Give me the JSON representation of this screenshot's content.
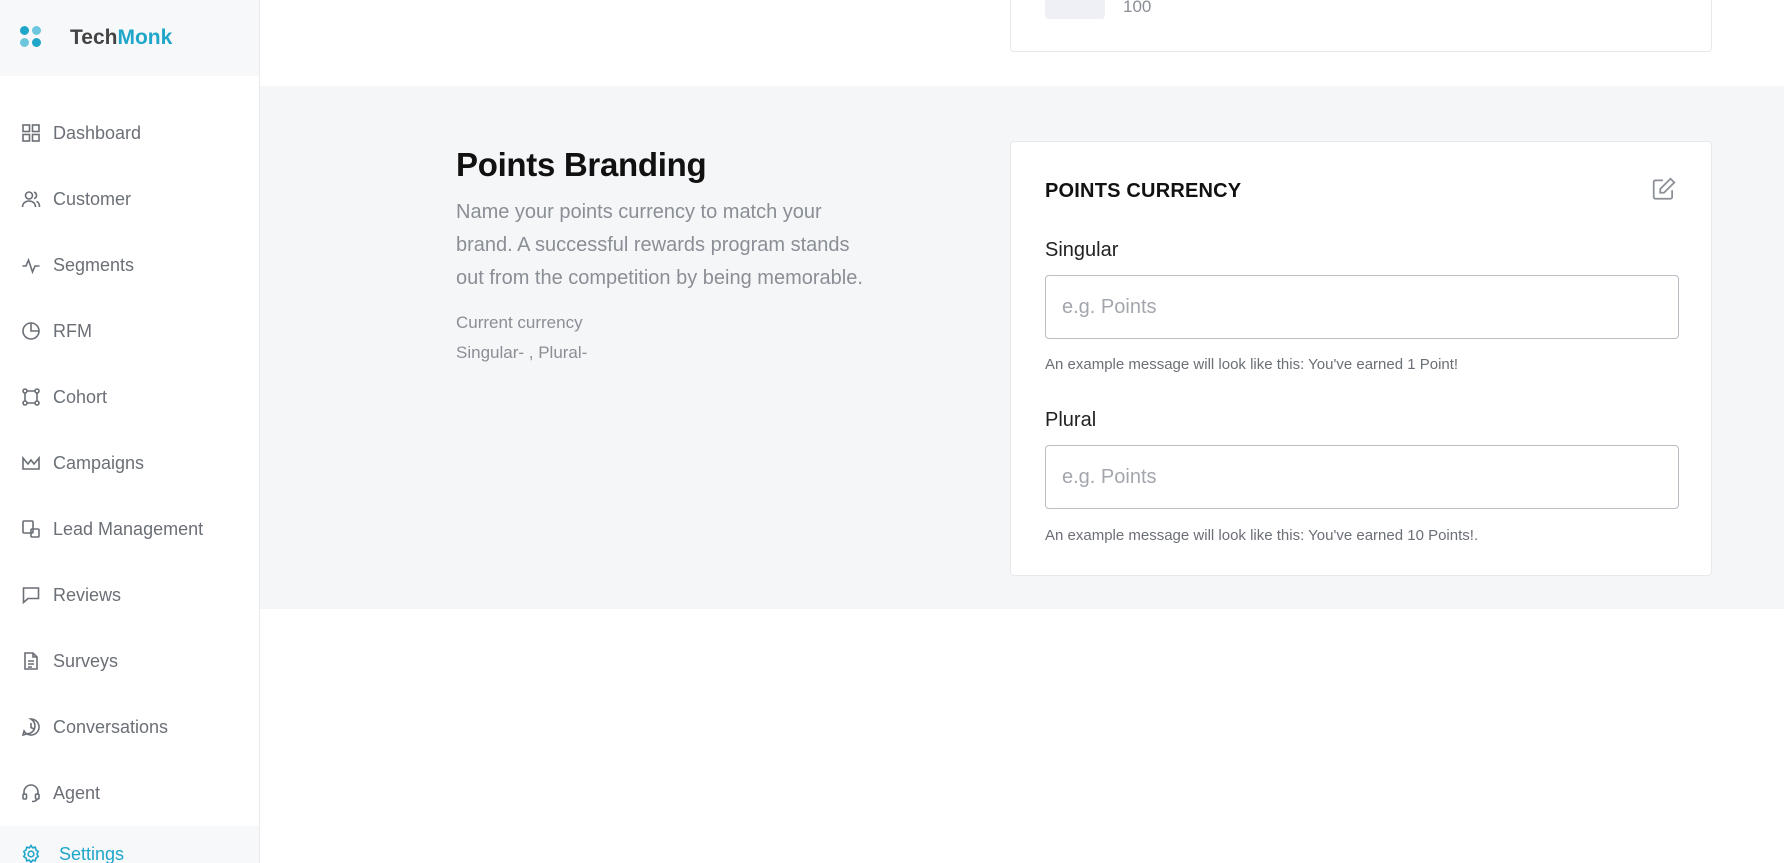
{
  "brand": {
    "name_part1": "Tech",
    "name_part2": "Monk",
    "accent_color": "#1fa6c9"
  },
  "sidebar": {
    "items": [
      {
        "label": "Dashboard",
        "icon": "grid-icon"
      },
      {
        "label": "Customer",
        "icon": "users-icon"
      },
      {
        "label": "Segments",
        "icon": "activity-icon"
      },
      {
        "label": "RFM",
        "icon": "pie-chart-icon"
      },
      {
        "label": "Cohort",
        "icon": "cohort-icon"
      },
      {
        "label": "Campaigns",
        "icon": "campaign-icon"
      },
      {
        "label": "Lead Management",
        "icon": "lead-icon"
      },
      {
        "label": "Reviews",
        "icon": "message-square-icon"
      },
      {
        "label": "Surveys",
        "icon": "file-text-icon"
      },
      {
        "label": "Conversations",
        "icon": "chat-icon"
      },
      {
        "label": "Agent",
        "icon": "headset-icon"
      },
      {
        "label": "Settings",
        "icon": "gear-icon",
        "active": true
      }
    ]
  },
  "top_card": {
    "value": "100"
  },
  "points_branding": {
    "title": "Points Branding",
    "description": "Name your points currency to match your brand. A successful rewards program stands out from the competition by being memorable.",
    "current_currency_label": "Current currency",
    "current_currency_value": "Singular- , Plural-"
  },
  "points_currency": {
    "title": "POINTS CURRENCY",
    "singular": {
      "label": "Singular",
      "placeholder": "e.g. Points",
      "value": "",
      "hint": "An example message will look like this: You've earned 1 Point!"
    },
    "plural": {
      "label": "Plural",
      "placeholder": "e.g. Points",
      "value": "",
      "hint": "An example message will look like this: You've earned 10 Points!."
    }
  }
}
